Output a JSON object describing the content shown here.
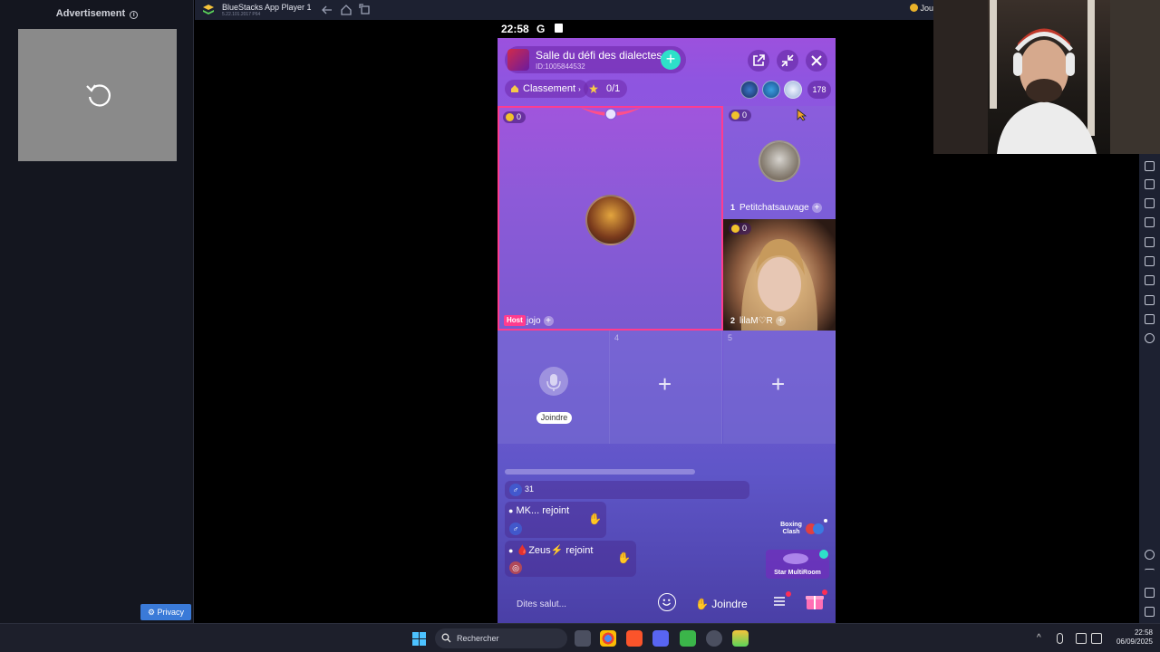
{
  "advertisement": {
    "title": "Advertisement",
    "info_icon": "info-icon",
    "reload_icon": "reload-icon",
    "privacy_label": "Privacy"
  },
  "bluestacks": {
    "title": "BlueStacks App Player 1",
    "version": "5.22.101.2017 P64",
    "user_label": "Jou",
    "nav_icons": [
      "back-arrow-icon",
      "home-icon",
      "recent-apps-icon"
    ]
  },
  "status_bar": {
    "time": "22:58",
    "g_label": "G"
  },
  "room": {
    "name": "Salle du défi des dialectes",
    "id": "ID:1005844532",
    "classement_label": "Classement",
    "classement_suffix": "›",
    "stars_label": "0/1",
    "viewer_count": "178"
  },
  "seats": {
    "host": {
      "coins": "0",
      "tag": "Host",
      "name": "jojo"
    },
    "seat1": {
      "coins": "0",
      "number": "1",
      "name": "Petitchatsauvage"
    },
    "seat2": {
      "coins": "0",
      "number": "2",
      "name": "lilaM♡R"
    },
    "seat3": {
      "join_label": "Joindre"
    },
    "seat4": {
      "number": "4"
    },
    "seat5": {
      "number": "5"
    }
  },
  "chat": {
    "count_line": "31",
    "messages": [
      {
        "user": "MK...",
        "action": "rejoint"
      },
      {
        "user": "🩸Zeus⚡",
        "action": "rejoint"
      }
    ]
  },
  "promos": {
    "boxing": "Boxing Clash",
    "multiroom": "Star MultiRoom"
  },
  "bottom_bar": {
    "say_hi_placeholder": "Dites salut...",
    "join_label": "Joindre"
  },
  "taskbar": {
    "search_label": "Rechercher",
    "time": "22:58",
    "date": "06/09/2025"
  },
  "colors": {
    "host_border": "#ff3c8e",
    "accent_teal": "#2ee0c9",
    "bs_bar": "#1d2131"
  }
}
